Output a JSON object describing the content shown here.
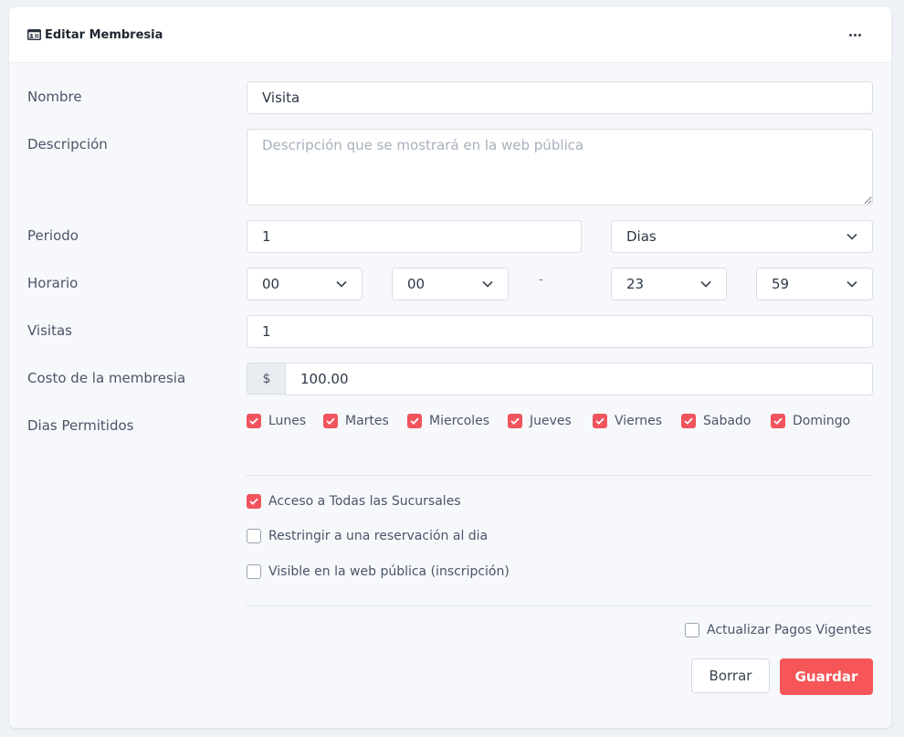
{
  "header": {
    "title": "Editar Membresia",
    "icon": "id-card-icon",
    "more_icon": "more-dots-icon"
  },
  "fields": {
    "nombre": {
      "label": "Nombre",
      "value": "Visita"
    },
    "descripcion": {
      "label": "Descripción",
      "value": "",
      "placeholder": "Descripción que se mostrará en la web pública"
    },
    "periodo": {
      "label": "Periodo",
      "value": "1",
      "unit": "Dias"
    },
    "horario": {
      "label": "Horario",
      "start_hour": "00",
      "start_min": "00",
      "separator": "-",
      "end_hour": "23",
      "end_min": "59"
    },
    "visitas": {
      "label": "Visitas",
      "value": "1"
    },
    "costo": {
      "label": "Costo de la membresia",
      "currency": "$",
      "value": "100.00"
    },
    "dias": {
      "label": "Dias Permitidos",
      "items": [
        {
          "label": "Lunes",
          "checked": true
        },
        {
          "label": "Martes",
          "checked": true
        },
        {
          "label": "Miercoles",
          "checked": true
        },
        {
          "label": "Jueves",
          "checked": true
        },
        {
          "label": "Viernes",
          "checked": true
        },
        {
          "label": "Sabado",
          "checked": true
        },
        {
          "label": "Domingo",
          "checked": true
        }
      ]
    }
  },
  "options": [
    {
      "label": "Acceso a Todas las Sucursales",
      "checked": true
    },
    {
      "label": "Restringir a una reservación al dia",
      "checked": false
    },
    {
      "label": "Visible en la web pública (inscripción)",
      "checked": false
    }
  ],
  "footer": {
    "actualizar": {
      "label": "Actualizar Pagos Vigentes",
      "checked": false
    },
    "borrar_label": "Borrar",
    "guardar_label": "Guardar"
  },
  "colors": {
    "accent": "#f65658",
    "checkbox": "#f1545d"
  }
}
